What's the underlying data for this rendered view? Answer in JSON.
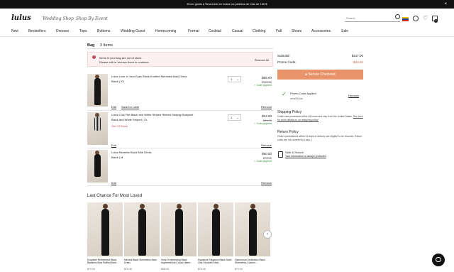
{
  "promo_bar": {
    "text": "Envío gratis a Venezuela en todos los pedidos de más de 150 $",
    "close": "×"
  },
  "header": {
    "logo": "lulus",
    "sub_brands": [
      "Wedding Shop",
      "Shop By Event"
    ],
    "search_placeholder": "Search",
    "bag_count": "0"
  },
  "nav": [
    "New",
    "Bestsellers",
    "Dresses",
    "Tops",
    "Bottoms",
    "Wedding Guest",
    "Homecoming",
    "Formal",
    "Cocktail",
    "Casual",
    "Clothing",
    "Fall",
    "Shoes",
    "Accessories",
    "Sale"
  ],
  "bag": {
    "title": "Bag",
    "count": "3 Items",
    "alert_line1": "Items in your bag are out of stock.",
    "alert_line2": "Please edit or remove them to continue.",
    "alert_action": "Remove All",
    "items": [
      {
        "name": "Lulus Lose In Your Eyes Black Knotted Mermaid Maxi Dress",
        "attrs": "Black  |  2X",
        "qty": "1",
        "price": "$55.00",
        "old": "$110.00",
        "code": "✓ Code Applied",
        "edit": "Edit",
        "save": "Save for Later",
        "remove": "Remove",
        "out_of_stock": ""
      },
      {
        "name": "Lulus Chic Flirt Black and White Striped Ribbed Strappy Bodysuit",
        "attrs": "Black and White Striped  |  XL",
        "qty": "1",
        "price": "$24.00",
        "old": "$31.00",
        "code": "✓ Code Applied",
        "edit": "Edit",
        "save": "",
        "remove": "Remove",
        "out_of_stock": "Out Of Stock"
      },
      {
        "name": "Lulus Remette Black Midi Dress",
        "attrs": "Black  |  M",
        "qty": "",
        "price": "$60.50",
        "old": "$76.00",
        "code": "✓ Code Applied",
        "edit": "Edit",
        "save": "",
        "remove": "Remove",
        "out_of_stock": ""
      }
    ]
  },
  "summary": {
    "subtotal_label": "Subtotal:",
    "subtotal_value": "$217.00",
    "promo_label": "Promo Code:",
    "promo_value": "-$43.40",
    "checkout": "Secure Checkout",
    "promo_applied": "Promo Code Applied",
    "promo_code": "new2lulus",
    "promo_remove": "Remove",
    "shipping_h": "Shipping Policy",
    "shipping_t": "Orders are processed within 48 hours and ship from the United States.",
    "shipping_link": "See here for more details on our shipping policy!",
    "return_h": "Return Policy",
    "return_t": "Orders postmarked within 21 days of delivery are eligible to be returned. Return costs are not covered by Lulus. |",
    "safe_h": "Safe & Secure",
    "safe_t": "Your information is always protected"
  },
  "last_chance": {
    "title": "Last Chance For Most Loved",
    "items": [
      {
        "name": "Exquisite Refinement Black Backless Bow Ruffled Maxi...",
        "price": "$70.00"
      },
      {
        "name": "Meloria Black Sleeveless Maxi Dress",
        "price": "$70.00"
      },
      {
        "name": "Keep It Interesting Black Asymmetrical Cutout Halter...",
        "price": "$58.00"
      },
      {
        "name": "Signature Elegance Black Satin One-Shoulder Maxi...",
        "price": "$70.00"
      },
      {
        "name": "Glamorous Dedication Black Sleeveless Column...",
        "price": "$70.00"
      }
    ],
    "next": "›"
  }
}
